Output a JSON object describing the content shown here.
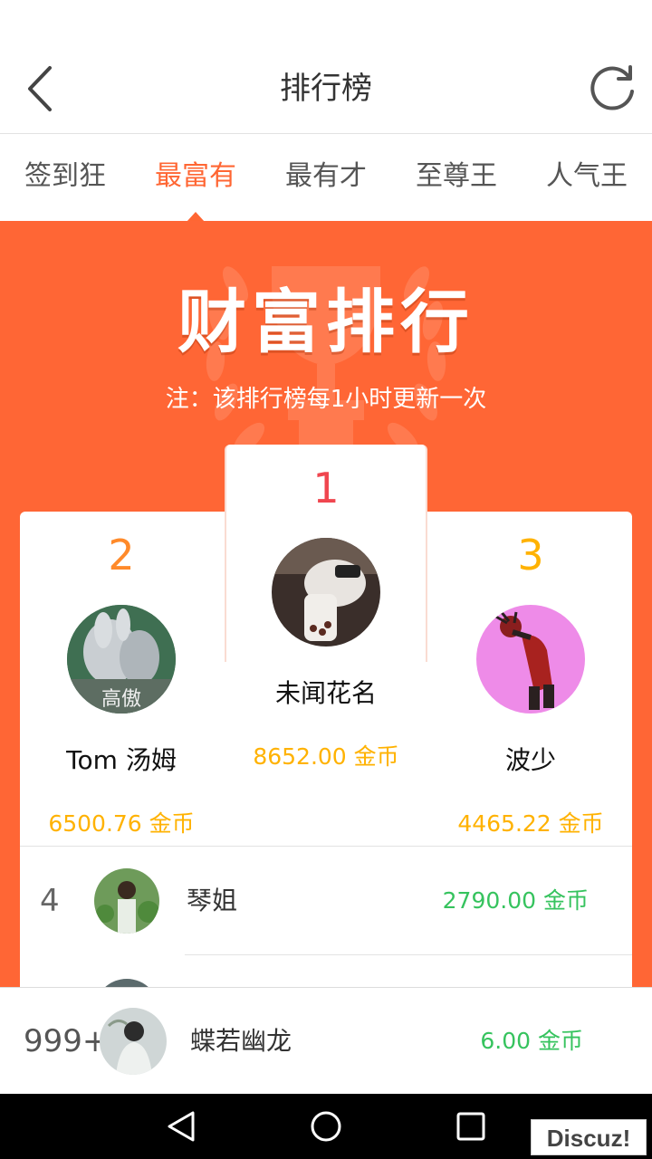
{
  "header": {
    "title": "排行榜",
    "back_icon": "chevron-left-icon",
    "refresh_icon": "refresh-icon"
  },
  "tabs": [
    {
      "label": "签到狂",
      "active": false
    },
    {
      "label": "最富有",
      "active": true
    },
    {
      "label": "最有才",
      "active": false
    },
    {
      "label": "至尊王",
      "active": false
    },
    {
      "label": "人气王",
      "active": false
    }
  ],
  "banner": {
    "title": "财富排行",
    "note": "注：该排行榜每1小时更新一次"
  },
  "podium": {
    "first": {
      "rank": "1",
      "name": "未闻花名",
      "coins": "8652.00 金币"
    },
    "second": {
      "rank": "2",
      "name": "Tom 汤姆",
      "coins": "6500.76 金币",
      "avatar_text": "高傲"
    },
    "third": {
      "rank": "3",
      "name": "波少",
      "coins": "4465.22 金币"
    }
  },
  "list": [
    {
      "rank": "4",
      "name": "琴姐",
      "coins": "2790.00 金币"
    }
  ],
  "my_rank": {
    "rank": "999+",
    "name": "蝶若幽龙",
    "coins": "6.00 金币"
  },
  "watermark": "Discuz!",
  "colors": {
    "accent": "#ff6633",
    "banner": "#ff6635",
    "gold": "#ffb200",
    "green": "#36c35e",
    "rank1": "#f0464f",
    "rank2": "#ff8a2a",
    "rank3": "#ffb200"
  }
}
